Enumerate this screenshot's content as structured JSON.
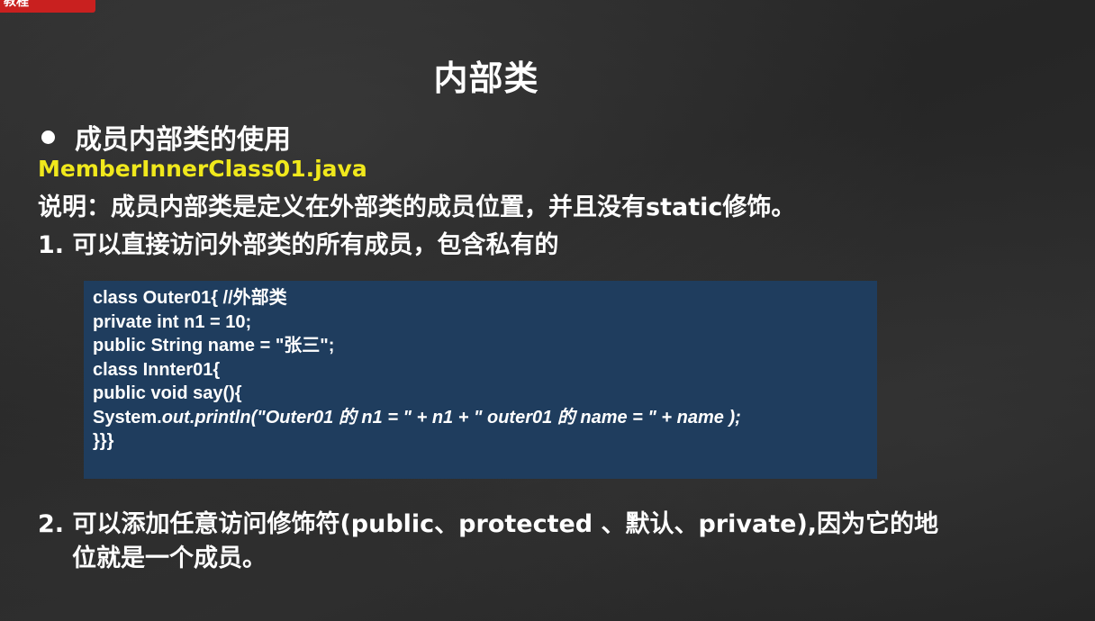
{
  "corner_tab": {
    "label": "教程"
  },
  "slide": {
    "title": "内部类",
    "bullet": "成员内部类的使用",
    "filename": "MemberInnerClass01.java",
    "note": "说明：成员内部类是定义在外部类的成员位置，并且没有static修饰。",
    "point1": "1. 可以直接访问外部类的所有成员，包含私有的",
    "point2_line1": "2. 可以添加任意访问修饰符(public、protected 、默认、private),因为它的地",
    "point2_line2": "位就是一个成员。"
  },
  "code": {
    "line1": "class Outer01{ //外部类",
    "line2": "private int n1 = 10;",
    "line3": "public String name = \"张三\";",
    "line4": "class Innter01{",
    "line5": "public void say(){",
    "line6_prefix": "System.",
    "line6_italic": "out.println(\"Outer01 的 n1 = \" + n1 + \" outer01 的 name = \" + name );",
    "line7": "}}}"
  },
  "colors": {
    "background": "#2a2a2a",
    "code_box": "#1f3d5e",
    "filename": "#f0e81c",
    "corner_tab": "#c9201f"
  }
}
